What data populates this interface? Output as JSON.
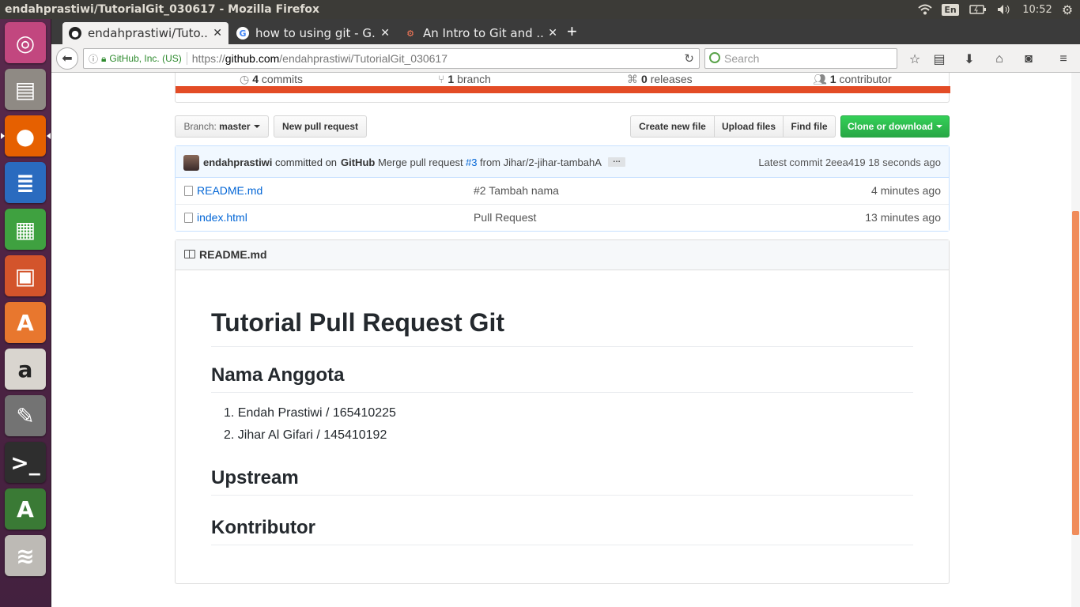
{
  "os_panel": {
    "window_title": "endahprastiwi/TutorialGit_030617 - Mozilla Firefox",
    "keyboard_layout": "En",
    "clock": "10:52"
  },
  "launcher": {
    "apps": [
      {
        "name": "ubuntu-dash-icon",
        "glyph": "◎",
        "color": "#c2477f"
      },
      {
        "name": "files-icon",
        "glyph": "▤",
        "color": "#8f8a84"
      },
      {
        "name": "firefox-icon",
        "glyph": "●",
        "color": "#e66000"
      },
      {
        "name": "libreoffice-writer-icon",
        "glyph": "≣",
        "color": "#2a6bbf"
      },
      {
        "name": "libreoffice-calc-icon",
        "glyph": "▦",
        "color": "#3fa140"
      },
      {
        "name": "libreoffice-impress-icon",
        "glyph": "▣",
        "color": "#d3542b"
      },
      {
        "name": "software-center-icon",
        "glyph": "A",
        "color": "#e8772e"
      },
      {
        "name": "amazon-icon",
        "glyph": "a",
        "color": "#d9d5cf"
      },
      {
        "name": "system-settings-icon",
        "glyph": "✎",
        "color": "#737373"
      },
      {
        "name": "terminal-icon",
        "glyph": ">_",
        "color": "#2e2e2e"
      },
      {
        "name": "software-updater-icon",
        "glyph": "A",
        "color": "#3a7a35"
      },
      {
        "name": "workspace-switcher-icon",
        "glyph": "≋",
        "color": "#bdbab5"
      }
    ]
  },
  "browser": {
    "tabs": [
      {
        "title": "endahprastiwi/Tuto...",
        "icon": "github-icon",
        "active": true
      },
      {
        "title": "how to using git - G...",
        "icon": "google-icon",
        "active": false
      },
      {
        "title": "An Intro to Git and ...",
        "icon": "hubspot-icon",
        "active": false
      }
    ],
    "identity_label": "GitHub, Inc. (US)",
    "url_scheme": "https://",
    "url_host": "github.com",
    "url_path": "/endahprastiwi/TutorialGit_030617",
    "search_placeholder": "Search"
  },
  "repo": {
    "stats": {
      "commits_count": "4",
      "commits_label": "commits",
      "branches_count": "1",
      "branches_label": "branch",
      "releases_count": "0",
      "releases_label": "releases",
      "contributors_count": "1",
      "contributors_label": "contributor"
    },
    "language_color": "#e34c26",
    "branch_prefix": "Branch:",
    "branch_name": "master",
    "new_pull_request": "New pull request",
    "create_new_file": "Create new file",
    "upload_files": "Upload files",
    "find_file": "Find file",
    "clone_or_download": "Clone or download",
    "latest_commit": {
      "author": "endahprastiwi",
      "committed_on": "committed on",
      "committer": "GitHub",
      "message_prefix": "Merge pull request",
      "pr_number": "#3",
      "message_suffix": "from Jihar/2-jihar-tambahA",
      "ellipsis": "…",
      "latest_commit_label": "Latest commit",
      "sha": "2eea419",
      "age": "18 seconds ago"
    },
    "files": [
      {
        "name": "README.md",
        "message": "#2 Tambah nama",
        "age": "4 minutes ago"
      },
      {
        "name": "index.html",
        "message": "Pull Request",
        "age": "13 minutes ago"
      }
    ],
    "readme": {
      "header": "README.md",
      "h1": "Tutorial Pull Request Git",
      "sections": [
        {
          "heading": "Nama Anggota"
        },
        {
          "heading": "Upstream"
        },
        {
          "heading": "Kontributor"
        }
      ],
      "members": [
        "1. Endah Prastiwi / 165410225",
        "2. Jihar Al Gifari / 145410192"
      ]
    }
  },
  "accent_colors": {
    "link": "#0366d6",
    "green_button": "#28a745",
    "commit_box": "#f1f8ff"
  }
}
